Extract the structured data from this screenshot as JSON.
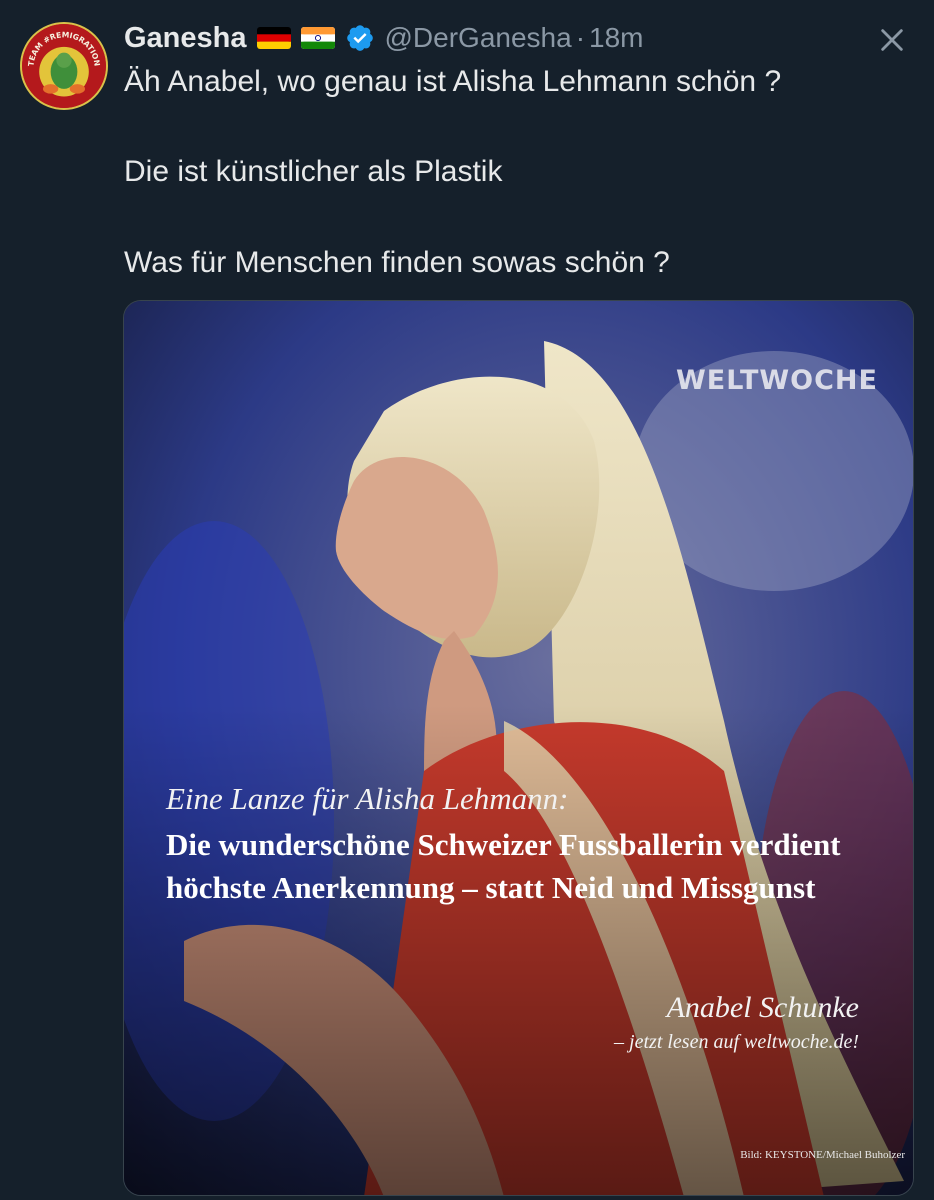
{
  "author": {
    "display_name": "Ganesha",
    "handle": "@DerGanesha",
    "separator": "·",
    "time": "18m",
    "avatar_text": "TEAM #REMIGRATION",
    "flags": [
      "flag-germany-icon",
      "flag-india-icon"
    ],
    "verified_icon": "verified-badge-icon",
    "verified_color": "#1d9bf0"
  },
  "close_icon": "close-icon",
  "text_lines": [
    "Äh Anabel, wo genau ist Alisha Lehmann schön ?",
    "Die ist künstlicher als Plastik",
    "Was für Menschen finden sowas schön ?"
  ],
  "media": {
    "watermark": "WELTWOCHE",
    "kicker": "Eine Lanze für Alisha Lehmann:",
    "headline": "Die wunderschöne Schweizer Fussballerin verdient höchste Anerkennung – statt Neid und Missgunst",
    "author": "Anabel Schunke",
    "read_more": "– jetzt lesen auf weltwoche.de!",
    "credit": "Bild: KEYSTONE/Michael Buholzer"
  },
  "colors": {
    "background": "#15202b",
    "text": "#e7e9ea",
    "secondary_text": "#8b98a5",
    "border": "#38444d"
  }
}
